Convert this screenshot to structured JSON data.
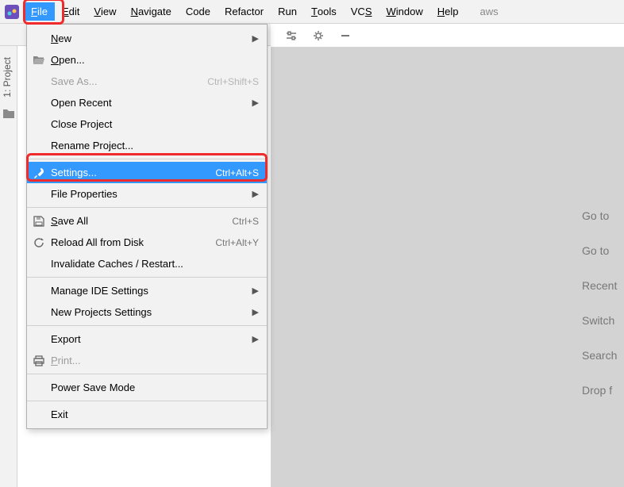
{
  "menubar": {
    "items": [
      {
        "label": "File",
        "mnemonic": 0,
        "active": true
      },
      {
        "label": "Edit",
        "mnemonic": 0
      },
      {
        "label": "View",
        "mnemonic": 0
      },
      {
        "label": "Navigate",
        "mnemonic": 0
      },
      {
        "label": "Code",
        "mnemonic": -1
      },
      {
        "label": "Refactor",
        "mnemonic": -1
      },
      {
        "label": "Run",
        "mnemonic": -1
      },
      {
        "label": "Tools",
        "mnemonic": 0
      },
      {
        "label": "VCS",
        "mnemonic": 2
      },
      {
        "label": "Window",
        "mnemonic": 0
      },
      {
        "label": "Help",
        "mnemonic": 0
      }
    ],
    "trailing": "aws"
  },
  "sidebar": {
    "tab_label": "1: Project"
  },
  "dropdown": {
    "items": [
      {
        "label": "New",
        "mn": 0,
        "submenu": true
      },
      {
        "label": "Open...",
        "mn": 0,
        "icon": "folder-open-icon"
      },
      {
        "label": "Save As...",
        "shortcut": "Ctrl+Shift+S",
        "disabled": true
      },
      {
        "label": "Open Recent",
        "submenu": true
      },
      {
        "label": "Close Project"
      },
      {
        "label": "Rename Project..."
      },
      {
        "sep": true
      },
      {
        "label": "Settings...",
        "shortcut": "Ctrl+Alt+S",
        "icon": "wrench-icon",
        "selected": true
      },
      {
        "label": "File Properties",
        "submenu": true
      },
      {
        "sep": true
      },
      {
        "label": "Save All",
        "mn": 0,
        "shortcut": "Ctrl+S",
        "icon": "save-icon"
      },
      {
        "label": "Reload All from Disk",
        "shortcut": "Ctrl+Alt+Y",
        "icon": "refresh-icon"
      },
      {
        "label": "Invalidate Caches / Restart..."
      },
      {
        "sep": true
      },
      {
        "label": "Manage IDE Settings",
        "submenu": true
      },
      {
        "label": "New Projects Settings",
        "submenu": true
      },
      {
        "sep": true
      },
      {
        "label": "Export",
        "submenu": true
      },
      {
        "label": "Print...",
        "mn": 0,
        "icon": "print-icon",
        "disabled": true
      },
      {
        "sep": true
      },
      {
        "label": "Power Save Mode"
      },
      {
        "sep": true
      },
      {
        "label": "Exit"
      }
    ]
  },
  "welcome": {
    "lines": [
      "Go to",
      "Go to",
      "Recent",
      "Switch",
      "Search",
      "Drop f"
    ]
  }
}
